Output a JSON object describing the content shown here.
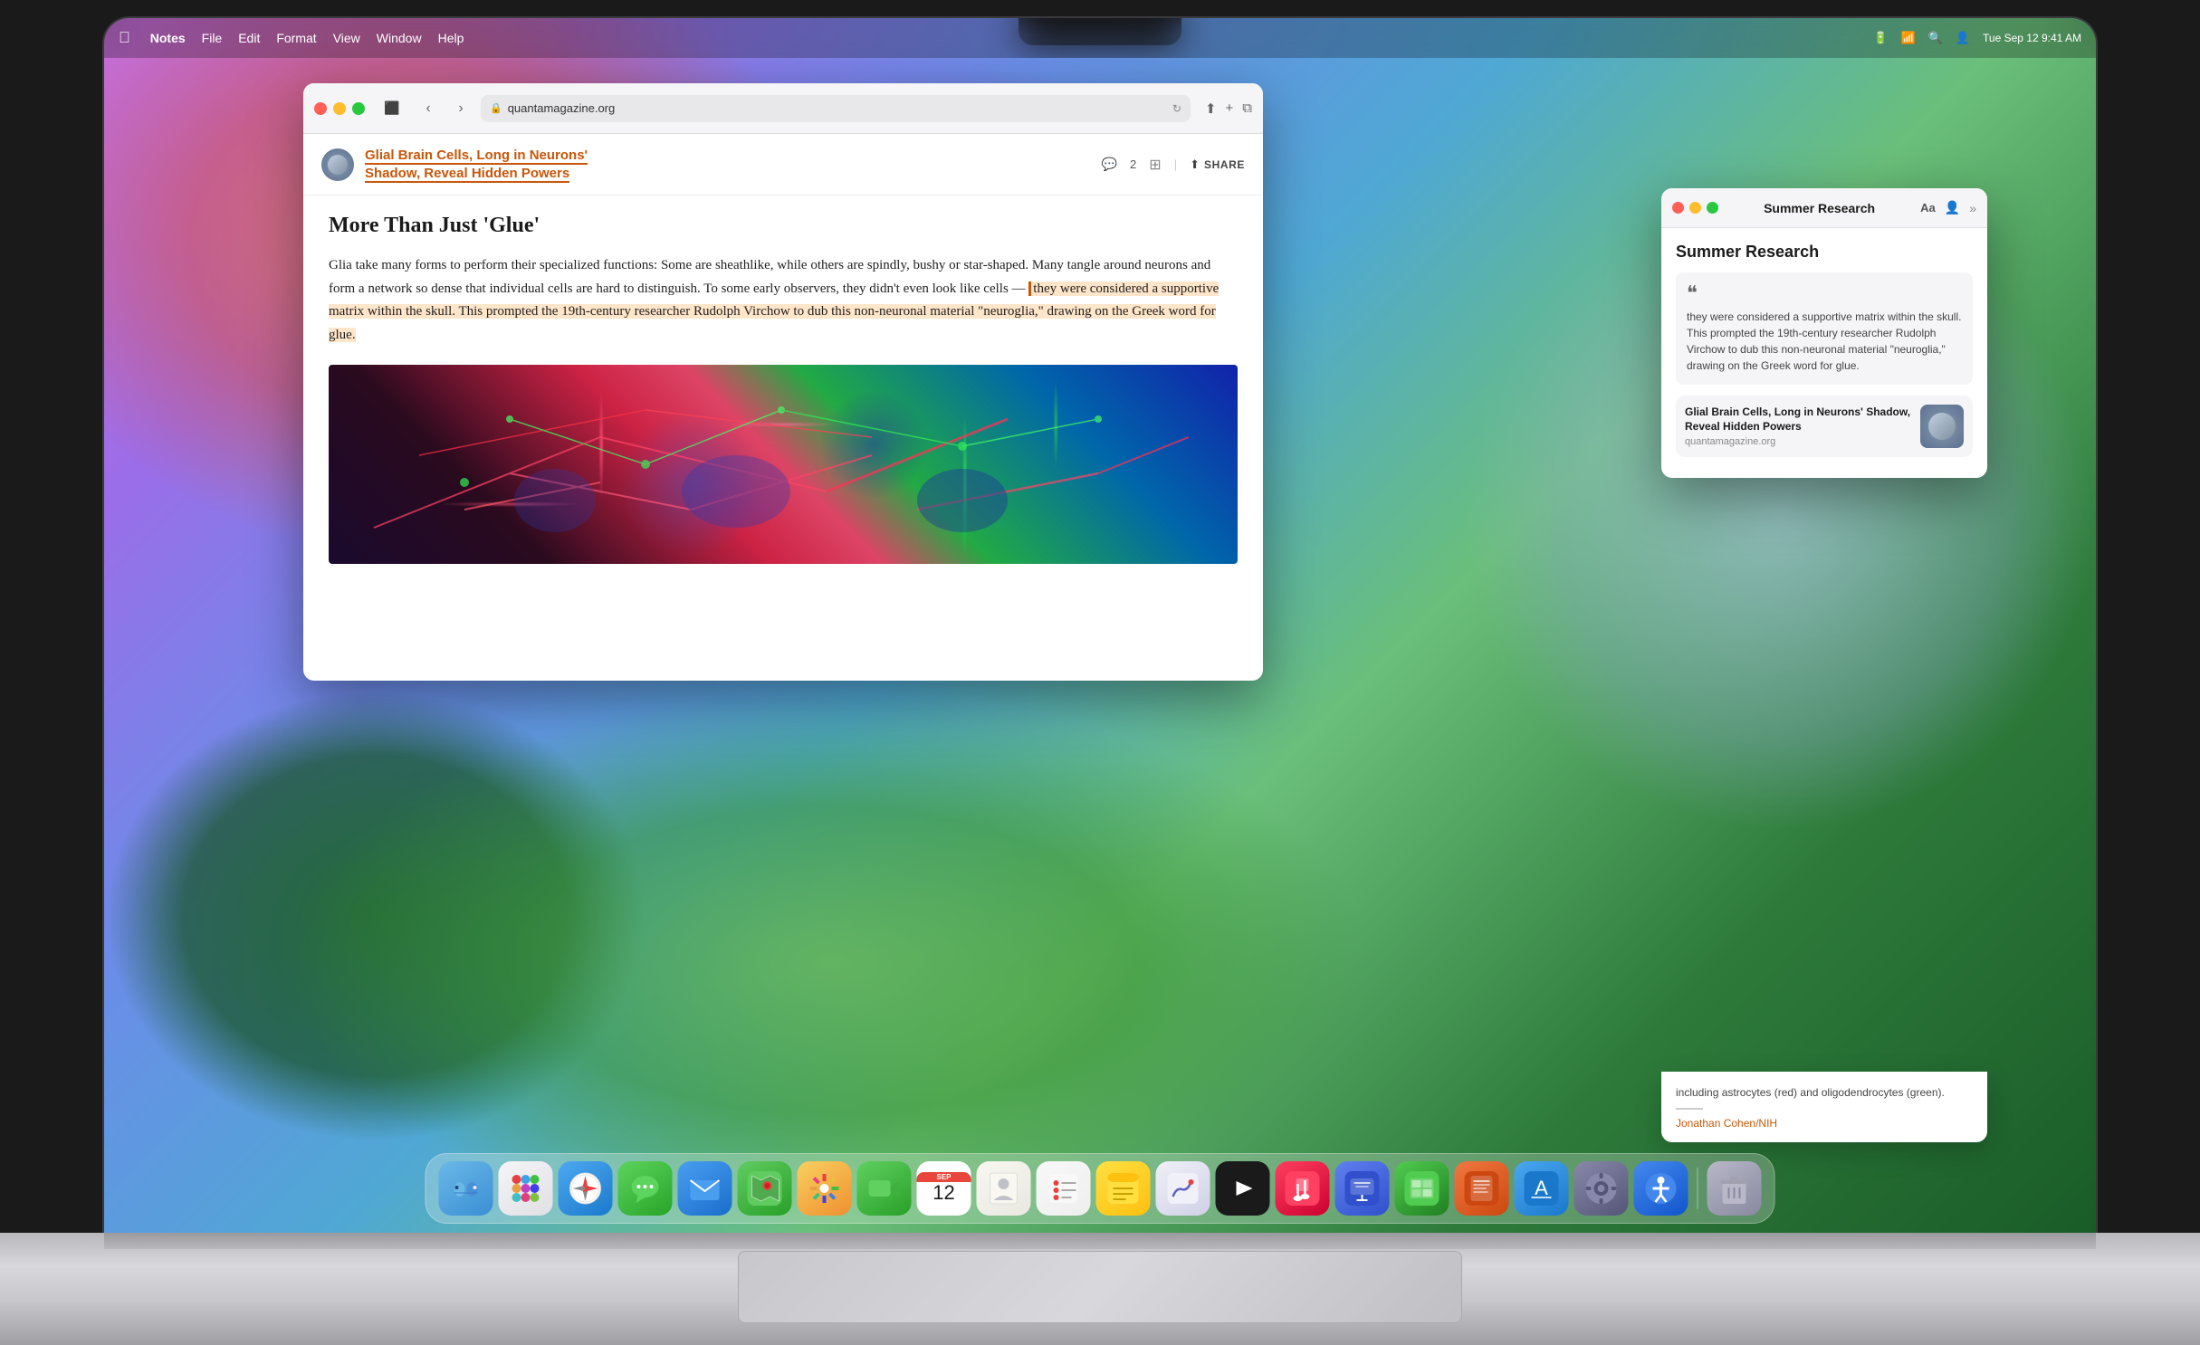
{
  "menubar": {
    "apple": "⌘",
    "app_name": "Notes",
    "menus": [
      "File",
      "Edit",
      "Format",
      "View",
      "Window",
      "Help"
    ],
    "right": {
      "battery": "▮▮▮",
      "wifi": "WiFi",
      "search": "🔍",
      "user": "👤",
      "datetime": "Tue Sep 12  9:41 AM"
    }
  },
  "safari": {
    "url": "quantamagazine.org",
    "article_header": {
      "title_line1": "Glial Brain Cells, Long in Neurons'",
      "title_line2": "Shadow, Reveal Hidden Powers",
      "title_highlighted": "Shadow, Reveal Hidden Powers",
      "comments_count": "2",
      "share_label": "SHARE"
    },
    "article": {
      "headline": "More Than Just 'Glue'",
      "body_intro": "Glia take many forms to perform their specialized functions: Some are sheathlike, while others are spindly, bushy or star-shaped. Many tangle around neurons and form a network so dense that individual cells are hard to distinguish. To some early observers, they didn't even look like cells — ",
      "body_highlight": "they were considered a supportive matrix within the skull. This prompted the 19th-century researcher Rudolph Virchow to dub this non-neuronal material \"neuroglia,\" drawing on the Greek word for glue.",
      "image_caption": "including astrocytes (red) and oligodendrocytes (green).",
      "image_attribution": "Jonathan Cohen/NIH"
    }
  },
  "notes": {
    "window_title": "Summer Research",
    "note_title": "Summer Research",
    "quote_text": "they were considered a supportive matrix within the skull. This prompted the 19th-century researcher Rudolph Virchow to dub this non-neuronal material \"neuroglia,\" drawing on the Greek word for glue.",
    "link_card": {
      "title": "Glial Brain Cells, Long in Neurons' Shadow, Reveal Hidden Powers",
      "domain": "quantamagazine.org"
    },
    "partial_text": "including astrocytes (red) and oligodendrocytes (green).",
    "attribution": "Jonathan Cohen/NIH",
    "toolbar_buttons": [
      "Aa",
      "👤",
      "»"
    ]
  },
  "dock": {
    "apps": [
      {
        "name": "Finder",
        "label": "🐕",
        "color_class": "dock-finder"
      },
      {
        "name": "Launchpad",
        "label": "⠿",
        "color_class": "dock-launchpad"
      },
      {
        "name": "Safari",
        "label": "🧭",
        "color_class": "dock-safari"
      },
      {
        "name": "Messages",
        "label": "💬",
        "color_class": "dock-messages"
      },
      {
        "name": "Mail",
        "label": "✉",
        "color_class": "dock-mail"
      },
      {
        "name": "Maps",
        "label": "🗺",
        "color_class": "dock-maps"
      },
      {
        "name": "Photos",
        "label": "🌅",
        "color_class": "dock-photos"
      },
      {
        "name": "FaceTime",
        "label": "📷",
        "color_class": "dock-facetime"
      },
      {
        "name": "Calendar",
        "label": "12",
        "color_class": "dock-calendar"
      },
      {
        "name": "Contacts",
        "label": "👤",
        "color_class": "dock-contacts"
      },
      {
        "name": "Reminders",
        "label": "☑",
        "color_class": "dock-reminders"
      },
      {
        "name": "Notes",
        "label": "📝",
        "color_class": "dock-notes"
      },
      {
        "name": "Freeform",
        "label": "✏",
        "color_class": "dock-freeform"
      },
      {
        "name": "AppleTV",
        "label": "▶",
        "color_class": "dock-appletv"
      },
      {
        "name": "Music",
        "label": "♪",
        "color_class": "dock-music"
      },
      {
        "name": "Keynote",
        "label": "K",
        "color_class": "dock-keynote"
      },
      {
        "name": "Numbers",
        "label": "N",
        "color_class": "dock-numbers"
      },
      {
        "name": "Pages",
        "label": "P",
        "color_class": "dock-pages"
      },
      {
        "name": "AppStore",
        "label": "A",
        "color_class": "dock-appstore"
      },
      {
        "name": "SystemPrefs",
        "label": "⚙",
        "color_class": "dock-systemprefs"
      },
      {
        "name": "Accessibility",
        "label": "◉",
        "color_class": "dock-accessibility"
      },
      {
        "name": "Trash",
        "label": "🗑",
        "color_class": "dock-trash"
      }
    ]
  }
}
